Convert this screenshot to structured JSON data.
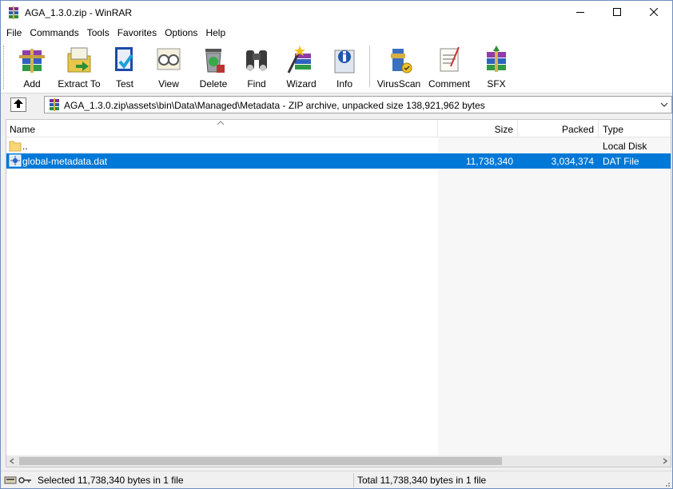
{
  "window": {
    "title": "AGA_1.3.0.zip - WinRAR"
  },
  "menu": [
    "File",
    "Commands",
    "Tools",
    "Favorites",
    "Options",
    "Help"
  ],
  "toolbar": {
    "buttons": [
      {
        "label": "Add",
        "icon": "add-archive-icon"
      },
      {
        "label": "Extract To",
        "icon": "extract-to-icon"
      },
      {
        "label": "Test",
        "icon": "test-icon"
      },
      {
        "label": "View",
        "icon": "view-icon"
      },
      {
        "label": "Delete",
        "icon": "delete-icon"
      },
      {
        "label": "Find",
        "icon": "find-icon"
      },
      {
        "label": "Wizard",
        "icon": "wizard-icon"
      },
      {
        "label": "Info",
        "icon": "info-icon"
      },
      {
        "label": "VirusScan",
        "icon": "virusscan-icon"
      },
      {
        "label": "Comment",
        "icon": "comment-icon"
      },
      {
        "label": "SFX",
        "icon": "sfx-icon"
      }
    ]
  },
  "address": {
    "path": "AGA_1.3.0.zip\\assets\\bin\\Data\\Managed\\Metadata - ZIP archive, unpacked size 138,921,962 bytes"
  },
  "columns": {
    "name": "Name",
    "size": "Size",
    "packed": "Packed",
    "type": "Type"
  },
  "files": [
    {
      "name": "..",
      "size": "",
      "packed": "",
      "type": "Local Disk",
      "icon": "folder-up-icon"
    },
    {
      "name": "global-metadata.dat",
      "size": "11,738,340",
      "packed": "3,034,374",
      "type": "DAT File",
      "icon": "dat-file-icon",
      "selected": true
    }
  ],
  "status": {
    "left": "Selected 11,738,340 bytes in 1 file",
    "right": "Total 11,738,340 bytes in 1 file"
  },
  "colors": {
    "selection": "#0078d7",
    "accent": "#6f8fbf"
  }
}
